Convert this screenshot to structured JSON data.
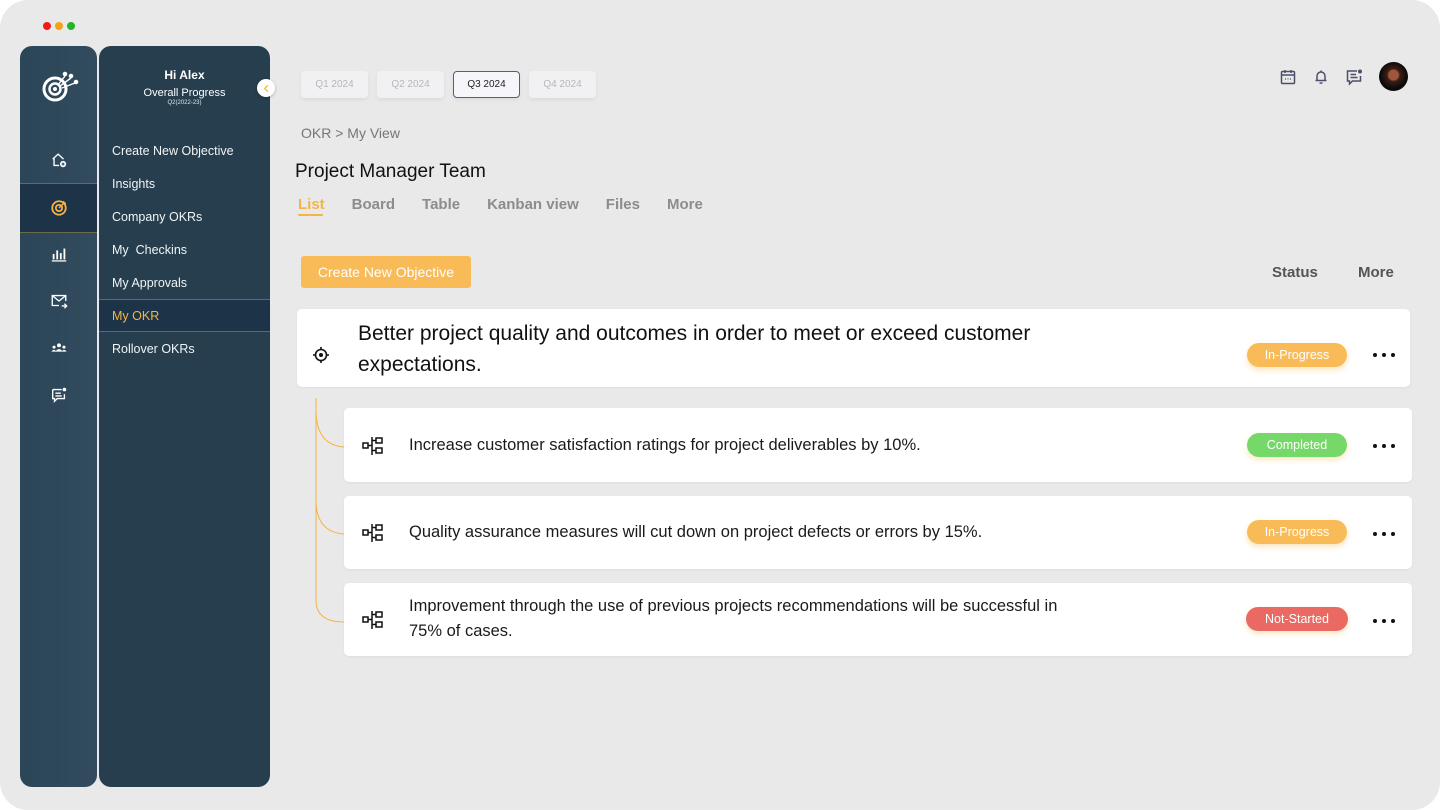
{
  "window": {
    "traffic_lights": [
      "#f21b1b",
      "#f2a318",
      "#1fb62a"
    ]
  },
  "rail": {
    "logo": "target-network-logo-icon",
    "items": [
      {
        "icon": "home-add-icon",
        "active": false
      },
      {
        "icon": "target-icon",
        "active": true
      },
      {
        "icon": "bar-chart-icon",
        "active": false
      },
      {
        "icon": "mail-forward-icon",
        "active": false
      },
      {
        "icon": "team-icon",
        "active": false
      },
      {
        "icon": "comment-notification-icon",
        "active": false
      }
    ]
  },
  "subnav": {
    "greeting": "Hi Alex",
    "overall_label": "Overall Progress",
    "period": "Q2(2022-23)",
    "collapse_icon": "chevron-left-icon",
    "items": [
      {
        "label": "Create New Objective",
        "active": false
      },
      {
        "label": "Insights",
        "active": false
      },
      {
        "label": "Company OKRs",
        "active": false
      },
      {
        "label": "My  Checkins",
        "active": false
      },
      {
        "label": "My Approvals",
        "active": false
      },
      {
        "label": "My OKR",
        "active": true
      },
      {
        "label": "Rollover OKRs",
        "active": false
      }
    ]
  },
  "quarters": [
    {
      "label": "Q1 2024",
      "active": false
    },
    {
      "label": "Q2 2024",
      "active": false
    },
    {
      "label": "Q3 2024",
      "active": true
    },
    {
      "label": "Q4 2024",
      "active": false
    }
  ],
  "top_icons": [
    "calendar-icon",
    "bell-icon",
    "message-notification-icon",
    "user-avatar"
  ],
  "breadcrumb": "OKR > My View",
  "page_title": "Project Manager Team",
  "view_tabs": [
    {
      "label": "List",
      "active": true
    },
    {
      "label": "Board",
      "active": false
    },
    {
      "label": "Table",
      "active": false
    },
    {
      "label": "Kanban view",
      "active": false
    },
    {
      "label": "Files",
      "active": false
    },
    {
      "label": "More",
      "active": false
    }
  ],
  "create_button": "Create New Objective",
  "columns": {
    "status": "Status",
    "more": "More"
  },
  "colors": {
    "accent": "#f6b443",
    "in_progress": "#f8bb58",
    "completed": "#77d86a",
    "not_started": "#ea6a63",
    "sidebar": "#263e4d"
  },
  "objective": {
    "icon": "crosshair-icon",
    "title": "Better project quality and outcomes in order to meet or exceed customer expectations.",
    "status": "In-Progress"
  },
  "key_results": [
    {
      "icon": "hierarchy-icon",
      "text": "Increase customer satisfaction ratings for project deliverables by 10%.",
      "status": "Completed"
    },
    {
      "icon": "hierarchy-icon",
      "text": "Quality assurance measures will cut down on project defects or errors by 15%.",
      "status": "In-Progress"
    },
    {
      "icon": "hierarchy-icon",
      "text": "Improvement through the use of previous projects recommendations will be successful in 75% of cases.",
      "status": "Not-Started"
    }
  ]
}
